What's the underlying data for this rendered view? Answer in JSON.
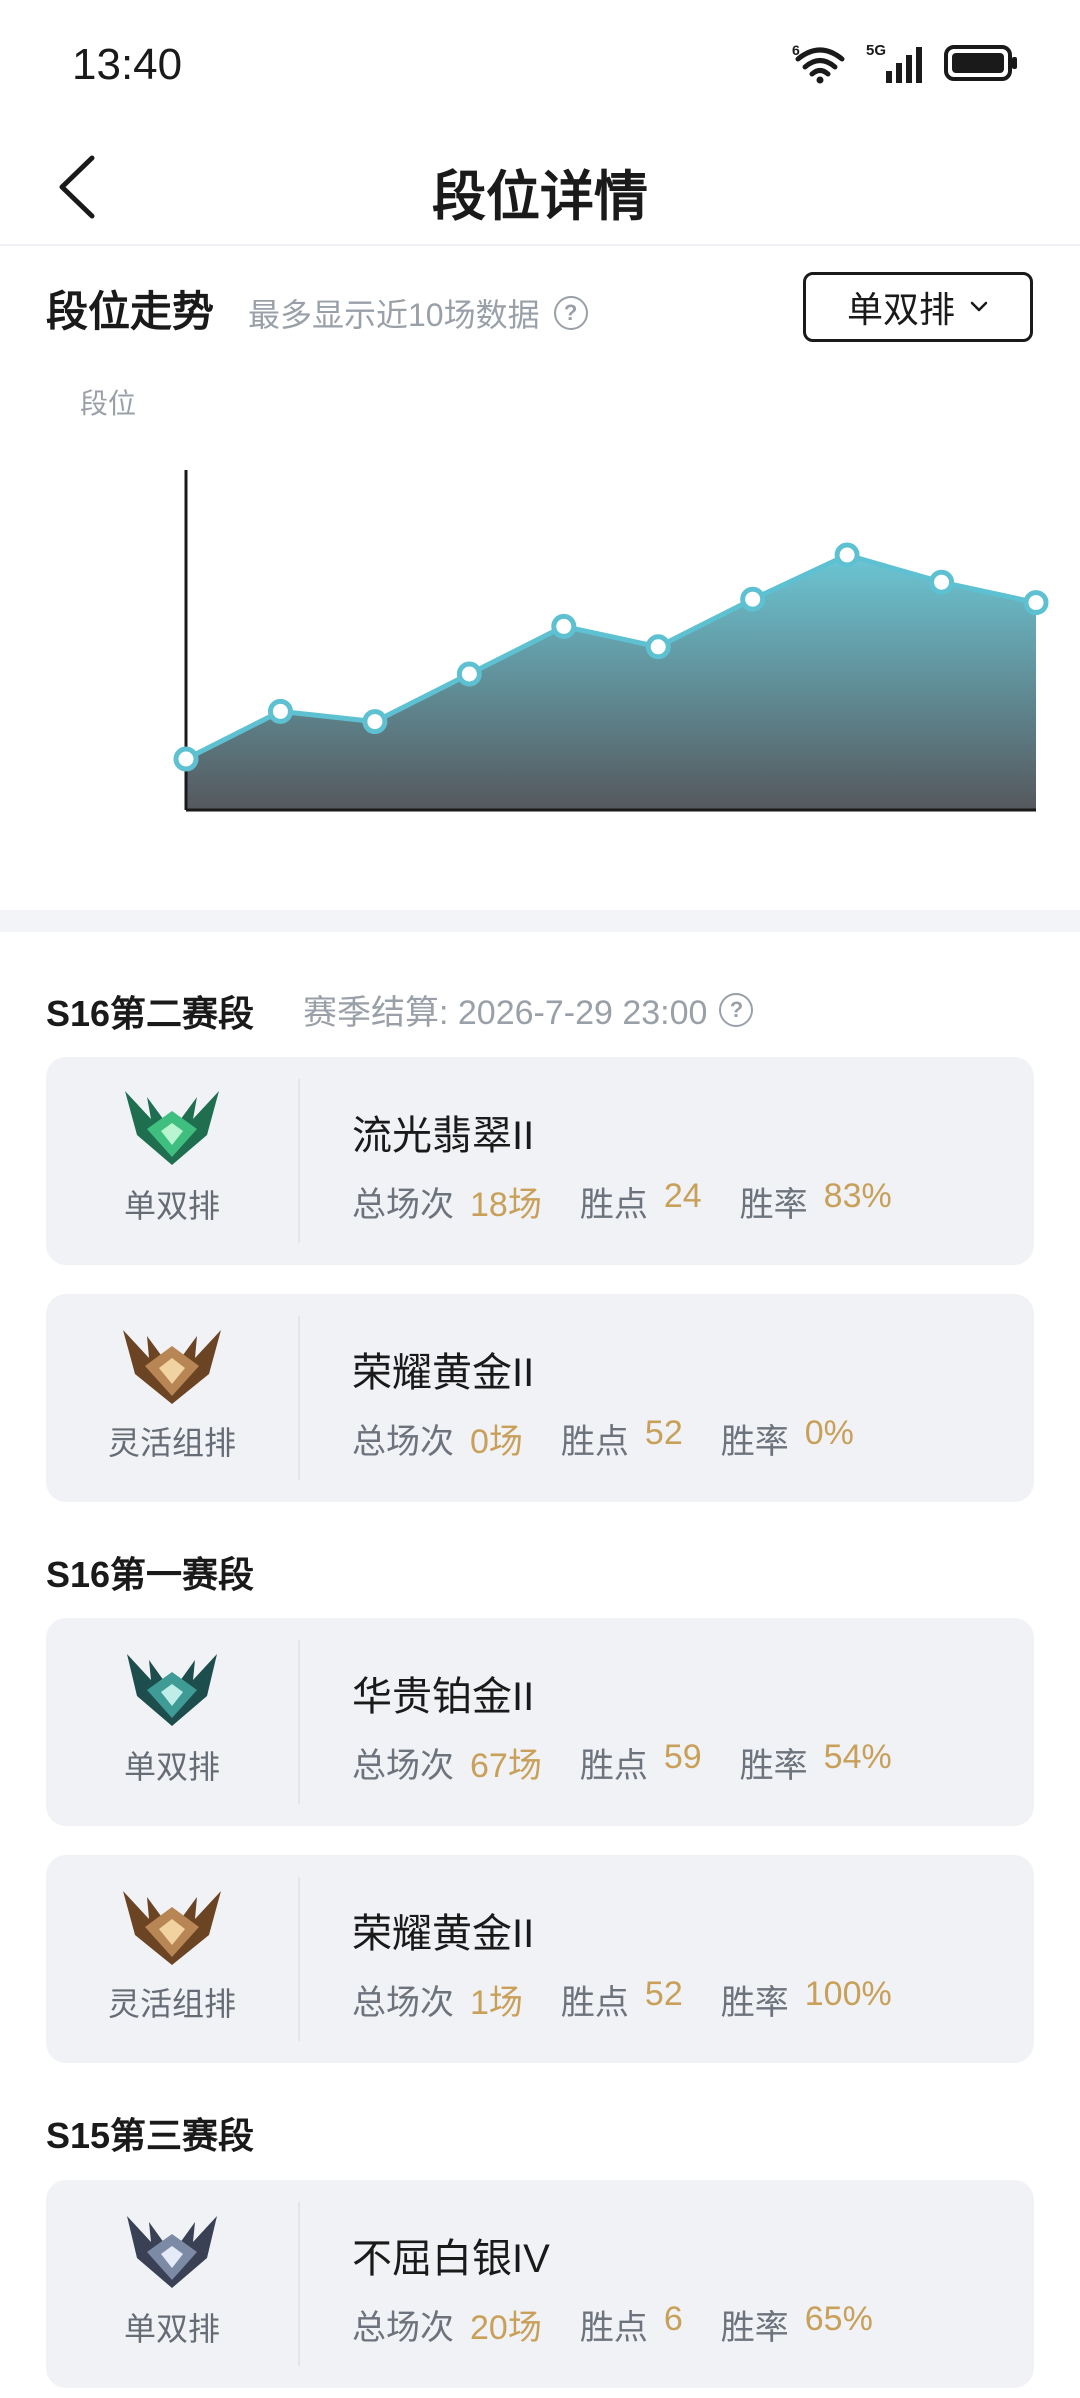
{
  "status": {
    "time": "13:40",
    "net_label": "5G",
    "wifi_label": "6"
  },
  "header": {
    "title": "段位详情"
  },
  "trend": {
    "title": "段位走势",
    "subtitle": "最多显示近10场数据",
    "help": "?",
    "queue_select": "单双排",
    "y_label": "段位"
  },
  "chart_data": {
    "type": "area",
    "title": "",
    "ylabel": "段位",
    "xlabel": "",
    "x": [
      1,
      2,
      3,
      4,
      5,
      6,
      7,
      8,
      9,
      10
    ],
    "values": [
      15,
      29,
      26,
      40,
      54,
      48,
      62,
      75,
      67,
      61
    ],
    "ylim": [
      0,
      100
    ],
    "grid": false,
    "colors": {
      "line": "#5ec1d1",
      "fill_top": "#6cc6d4",
      "fill_bottom": "#55585d"
    }
  },
  "seasons": [
    {
      "title": "S16第二赛段",
      "settlement": "赛季结算: 2026-7-29 23:00",
      "help": "?",
      "cards": [
        {
          "badge": "emerald-badge-icon",
          "queue": "单双排",
          "rank": "流光翡翠II",
          "games_label": "总场次",
          "games": "18场",
          "points_label": "胜点",
          "points": "24",
          "winrate_label": "胜率",
          "winrate": "83%"
        },
        {
          "badge": "gold-badge-icon",
          "queue": "灵活组排",
          "rank": "荣耀黄金II",
          "games_label": "总场次",
          "games": "0场",
          "points_label": "胜点",
          "points": "52",
          "winrate_label": "胜率",
          "winrate": "0%"
        }
      ]
    },
    {
      "title": "S16第一赛段",
      "cards": [
        {
          "badge": "platinum-badge-icon",
          "queue": "单双排",
          "rank": "华贵铂金II",
          "games_label": "总场次",
          "games": "67场",
          "points_label": "胜点",
          "points": "59",
          "winrate_label": "胜率",
          "winrate": "54%"
        },
        {
          "badge": "gold-badge-icon",
          "queue": "灵活组排",
          "rank": "荣耀黄金II",
          "games_label": "总场次",
          "games": "1场",
          "points_label": "胜点",
          "points": "52",
          "winrate_label": "胜率",
          "winrate": "100%"
        }
      ]
    },
    {
      "title": "S15第三赛段",
      "cards": [
        {
          "badge": "silver-badge-icon",
          "queue": "单双排",
          "rank": "不屈白银IV",
          "games_label": "总场次",
          "games": "20场",
          "points_label": "胜点",
          "points": "6",
          "winrate_label": "胜率",
          "winrate": "65%"
        }
      ]
    }
  ]
}
